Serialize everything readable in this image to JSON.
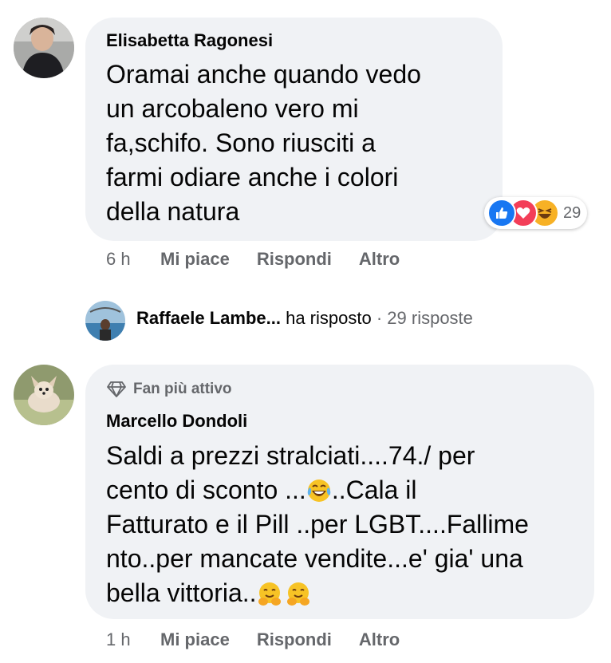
{
  "comment1": {
    "author": "Elisabetta Ragonesi",
    "lines": [
      "Oramai anche quando vedo",
      "un arcobaleno vero mi",
      "fa,schifo. Sono riusciti a",
      "farmi odiare anche i colori",
      "della natura"
    ],
    "reactions": {
      "icons": [
        "like-icon",
        "love-icon",
        "haha-icon"
      ],
      "count": "29",
      "colors": {
        "like": "#1877f2",
        "love": "#f33e58",
        "haha": "#f7b125"
      }
    },
    "time": "6 h",
    "actions": [
      "Mi piace",
      "Rispondi",
      "Altro"
    ]
  },
  "reply_summary": {
    "name": "Raffaele Lambe...",
    "verb": "ha risposto",
    "separator": "·",
    "count": "29 risposte"
  },
  "comment2": {
    "badge": "Fan più attivo",
    "author": "Marcello Dondoli",
    "line1": "Saldi a prezzi stralciati....74./ per",
    "line2_a": "cento di sconto ...",
    "line2_b": "..Cala il",
    "line3": "Fatturato e il Pill ..per LGBT....Fallime",
    "line4": "nto..per mancate vendite...e' gia' una",
    "line5": "bella vittoria..",
    "emojis": [
      "laughing-crying-emoji-icon",
      "hugging-face-emoji-icon",
      "hugging-face-emoji-icon"
    ],
    "time": "1 h",
    "actions": [
      "Mi piace",
      "Rispondi",
      "Altro"
    ]
  }
}
